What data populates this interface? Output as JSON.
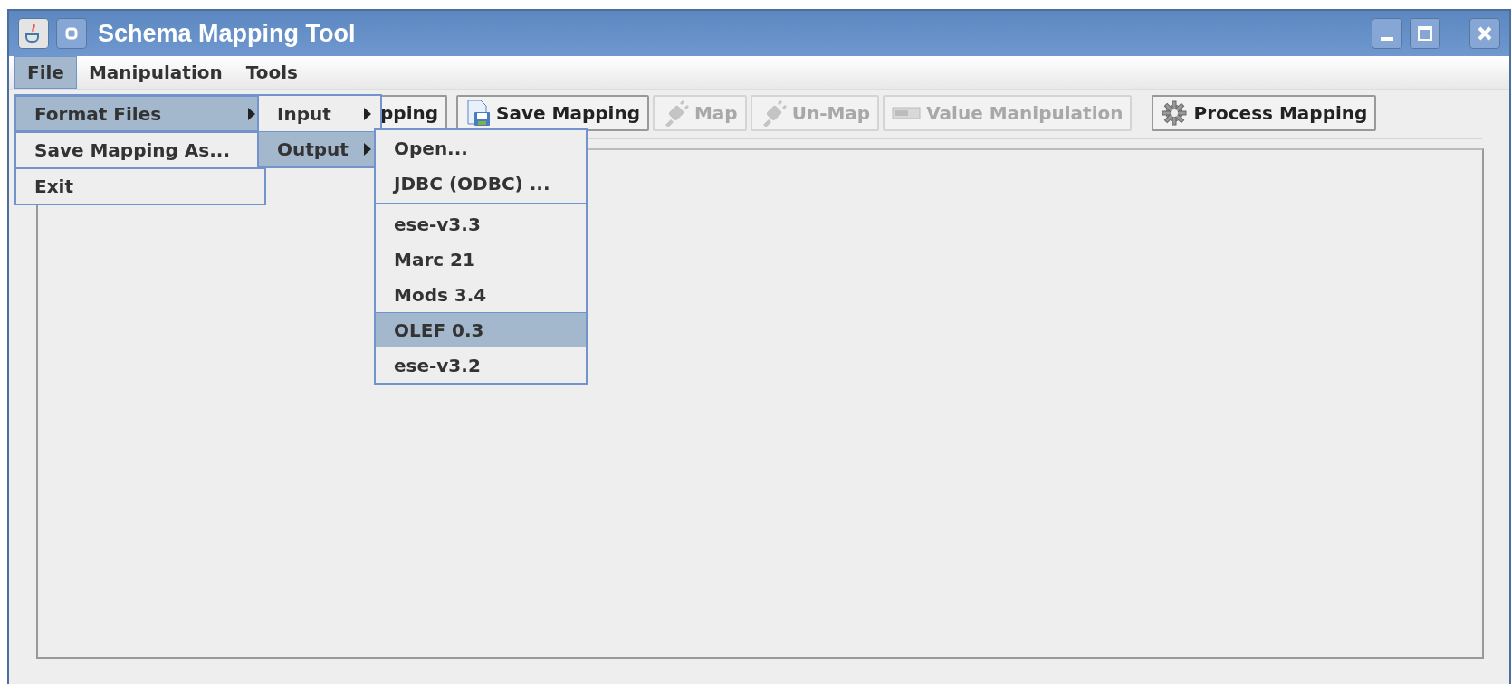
{
  "window": {
    "title": "Schema Mapping Tool"
  },
  "menu_bar": [
    {
      "label": "File",
      "selected": true
    },
    {
      "label": "Manipulation",
      "selected": false
    },
    {
      "label": "Tools",
      "selected": false
    }
  ],
  "toolbar": [
    {
      "label": "pping",
      "disabled": false
    },
    {
      "label": "Save Mapping",
      "disabled": false
    },
    {
      "label": "Map",
      "disabled": true
    },
    {
      "label": "Un-Map",
      "disabled": true
    },
    {
      "label": "Value Manipulation",
      "disabled": true
    },
    {
      "label": "Process Mapping",
      "disabled": false
    }
  ],
  "file_menu": [
    {
      "label": "Format Files",
      "selected": true,
      "has_submenu": true
    },
    {
      "label": "Save Mapping As...",
      "selected": false,
      "has_submenu": false
    },
    {
      "label": "Exit",
      "selected": false,
      "has_submenu": false
    }
  ],
  "format_files_submenu": [
    {
      "label": "Input",
      "selected": false,
      "has_submenu": true
    },
    {
      "label": "Output",
      "selected": true,
      "has_submenu": true
    }
  ],
  "output_submenu": [
    [
      {
        "label": "Open...",
        "selected": false
      },
      {
        "label": "JDBC (ODBC) ...",
        "selected": false
      }
    ],
    [
      {
        "label": "ese-v3.3",
        "selected": false
      },
      {
        "label": "Marc 21",
        "selected": false
      },
      {
        "label": "Mods 3.4",
        "selected": false
      },
      {
        "label": "OLEF 0.3",
        "selected": true
      },
      {
        "label": "ese-v3.2",
        "selected": false
      }
    ]
  ]
}
